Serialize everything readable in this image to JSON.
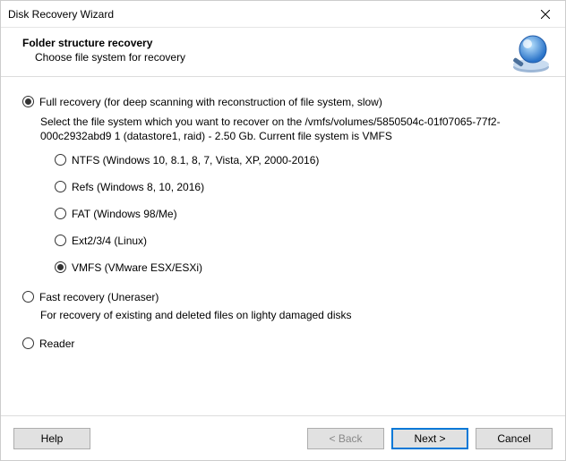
{
  "window": {
    "title": "Disk Recovery Wizard"
  },
  "header": {
    "title": "Folder structure recovery",
    "subtitle": "Choose file system for recovery"
  },
  "modes": {
    "full": {
      "label": "Full recovery (for deep scanning with reconstruction of file system, slow)",
      "selected": true,
      "description": "Select the file system which you want to recover on the /vmfs/volumes/5850504c-01f07065-77f2-000c2932abd9 1 (datastore1, raid) - 2.50 Gb. Current file system is VMFS",
      "filesystems": [
        {
          "label": "NTFS (Windows 10, 8.1, 8, 7, Vista, XP, 2000-2016)",
          "selected": false
        },
        {
          "label": "Refs (Windows 8, 10, 2016)",
          "selected": false
        },
        {
          "label": "FAT (Windows 98/Me)",
          "selected": false
        },
        {
          "label": "Ext2/3/4 (Linux)",
          "selected": false
        },
        {
          "label": "VMFS (VMware ESX/ESXi)",
          "selected": true
        }
      ]
    },
    "fast": {
      "label": "Fast recovery (Uneraser)",
      "selected": false,
      "description": "For recovery of existing and deleted files on lighty damaged disks"
    },
    "reader": {
      "label": "Reader",
      "selected": false
    }
  },
  "footer": {
    "help": "Help",
    "back": "< Back",
    "next": "Next >",
    "cancel": "Cancel"
  }
}
